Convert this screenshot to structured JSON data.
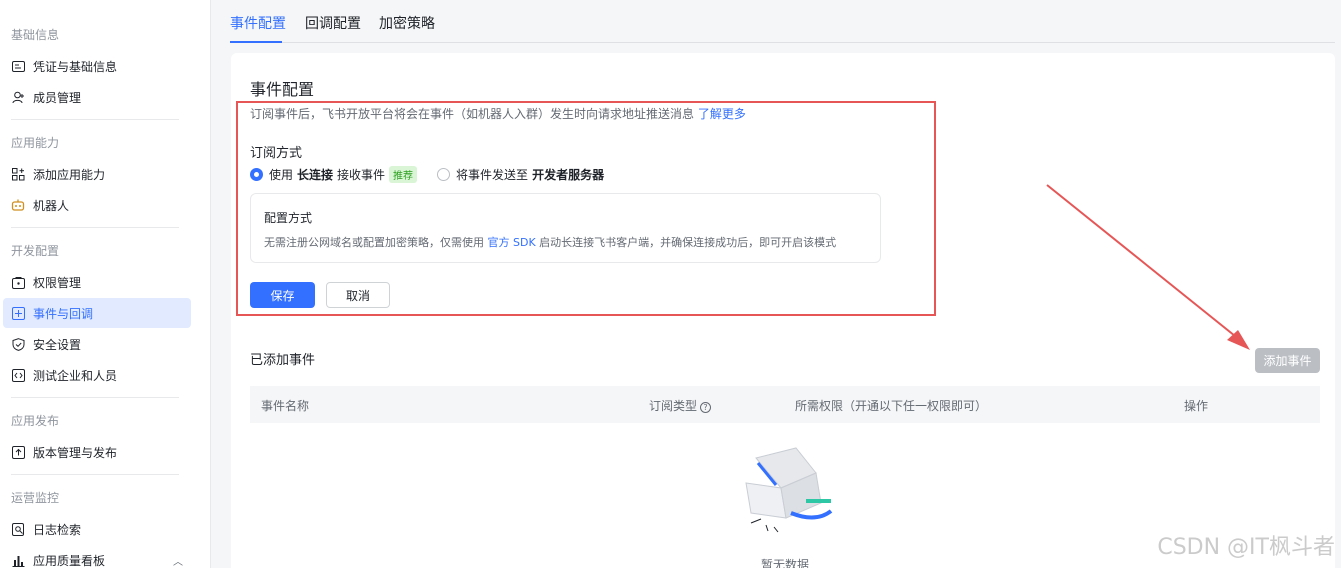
{
  "sidebar": {
    "groups": [
      {
        "title": "基础信息",
        "items": [
          {
            "label": "凭证与基础信息",
            "icon": "id-card-icon"
          },
          {
            "label": "成员管理",
            "icon": "user-add-icon"
          }
        ]
      },
      {
        "title": "应用能力",
        "items": [
          {
            "label": "添加应用能力",
            "icon": "grid-add-icon"
          },
          {
            "label": "机器人",
            "icon": "robot-icon"
          }
        ]
      },
      {
        "title": "开发配置",
        "items": [
          {
            "label": "权限管理",
            "icon": "lock-box-icon"
          },
          {
            "label": "事件与回调",
            "icon": "event-icon"
          },
          {
            "label": "安全设置",
            "icon": "shield-icon"
          },
          {
            "label": "测试企业和人员",
            "icon": "code-box-icon"
          }
        ]
      },
      {
        "title": "应用发布",
        "items": [
          {
            "label": "版本管理与发布",
            "icon": "upload-box-icon"
          }
        ]
      },
      {
        "title": "运营监控",
        "items": [
          {
            "label": "日志检索",
            "icon": "log-search-icon"
          },
          {
            "label": "应用质量看板",
            "icon": "bar-chart-icon"
          }
        ]
      }
    ]
  },
  "tabs": [
    {
      "label": "事件配置"
    },
    {
      "label": "回调配置"
    },
    {
      "label": "加密策略"
    }
  ],
  "main": {
    "title": "事件配置",
    "desc": "订阅事件后，飞书开放平台将会在事件（如机器人入群）发生时向请求地址推送消息",
    "desc_link": "了解更多",
    "subscribe_title": "订阅方式",
    "option1_pre": "使用",
    "option1_bold": "长连接",
    "option1_post": "接收事件",
    "option1_tag": "推荐",
    "option2_pre": "将事件发送至",
    "option2_bold": "开发者服务器",
    "config_title": "配置方式",
    "config_desc_pre": "无需注册公网域名或配置加密策略，仅需使用",
    "config_desc_link": "官方 SDK",
    "config_desc_post": "启动长连接飞书客户端，并确保连接成功后，即可开启该模式",
    "save_label": "保存",
    "cancel_label": "取消",
    "added_title": "已添加事件",
    "add_button": "添加事件",
    "columns": [
      "事件名称",
      "订阅类型",
      "所需权限（开通以下任一权限即可）",
      "操作"
    ],
    "empty_text": "暂无数据"
  },
  "watermark": "CSDN @IT枫斗者",
  "colors": {
    "accent": "#3370ff",
    "annotation": "#e65656"
  }
}
